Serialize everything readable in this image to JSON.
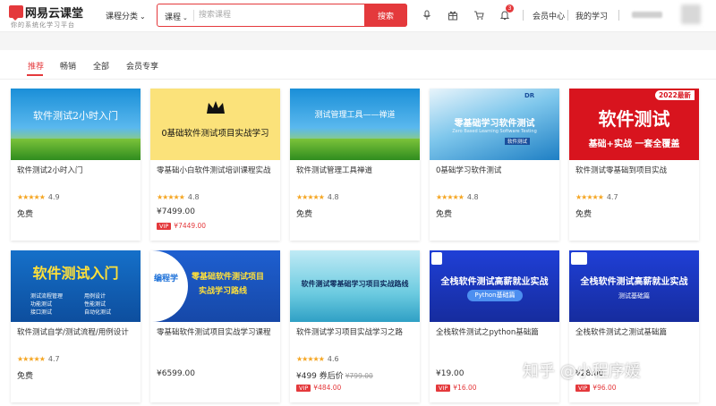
{
  "header": {
    "logo_text": "网易云课堂",
    "logo_sub": "你的系统化学习平台",
    "category_label": "课程分类",
    "search_type": "课程",
    "search_placeholder": "搜索课程",
    "search_button": "搜索",
    "notification_count": "3",
    "member_center": "会员中心",
    "my_learning": "我的学习",
    "icons": [
      "microphone-icon",
      "gift-icon",
      "cart-icon",
      "bell-icon"
    ]
  },
  "tabs": [
    {
      "label": "推荐",
      "active": true
    },
    {
      "label": "畅销",
      "active": false
    },
    {
      "label": "全部",
      "active": false
    },
    {
      "label": "会员专享",
      "active": false
    }
  ],
  "courses": [
    {
      "thumb_text": "软件测试2小时入门",
      "title": "软件测试2小时入门",
      "rating": "4.9",
      "price": "免费"
    },
    {
      "thumb_text": "0基础软件测试项目实战学习",
      "title": "零基础小白软件测试培训课程实战",
      "rating": "4.8",
      "price": "¥7499.00",
      "vip": "VIP",
      "vip_price": "¥7449.00"
    },
    {
      "thumb_text": "测试管理工具——禅道",
      "title": "软件测试管理工具禅道",
      "rating": "4.8",
      "price": "免费"
    },
    {
      "thumb_text": "零基础学习软件测试",
      "thumb_sub": "Zero Based Learning Software Testing",
      "thumb_tag": "软件测试",
      "thumb_logo": "DR",
      "title": "0基础学习软件测试",
      "rating": "4.8",
      "price": "免费"
    },
    {
      "thumb_text": "软件测试",
      "thumb_sub": "基础+实战 一套全覆盖",
      "thumb_tag": "2022最新",
      "title": "软件测试零基础到项目实战",
      "rating": "4.7",
      "price": "免费"
    },
    {
      "thumb_text": "软件测试入门",
      "thumb_lines": [
        "测试流程管理",
        "用例设计",
        "功能测试",
        "性能测试",
        "接口测试",
        "自动化测试"
      ],
      "title": "软件测试自学/测试流程/用例设计",
      "rating": "4.7",
      "price": "免费"
    },
    {
      "thumb_text": "零基础软件测试项目",
      "thumb_sub": "实战学习路线",
      "thumb_logo": "编程学",
      "title": "零基础软件测试项目实战学习课程",
      "rating": "",
      "price": "¥6599.00"
    },
    {
      "thumb_text": "软件测试零基础学习项目实战路线",
      "title": "软件测试学习项目实战学习之路",
      "rating": "4.6",
      "price": "¥499 券后价",
      "orig_price": "¥799.00",
      "vip": "VIP",
      "vip_price": "¥484.00"
    },
    {
      "thumb_text": "全栈软件测试高薪就业实战",
      "thumb_sub": "Python基础篇",
      "title": "全栈软件测试之python基础篇",
      "rating": "",
      "price": "¥19.00",
      "vip": "VIP",
      "vip_price": "¥16.00"
    },
    {
      "thumb_text": "全栈软件测试高薪就业实战",
      "thumb_sub": "测试基础篇",
      "title": "全栈软件测试之测试基础篇",
      "rating": "",
      "price": "¥28.00",
      "vip": "VIP",
      "vip_price": "¥96.00"
    }
  ],
  "stars": "★★★★★",
  "watermark": "知乎 @小程序媛",
  "colors": {
    "accent": "#e4393c",
    "star": "#f5a623"
  }
}
